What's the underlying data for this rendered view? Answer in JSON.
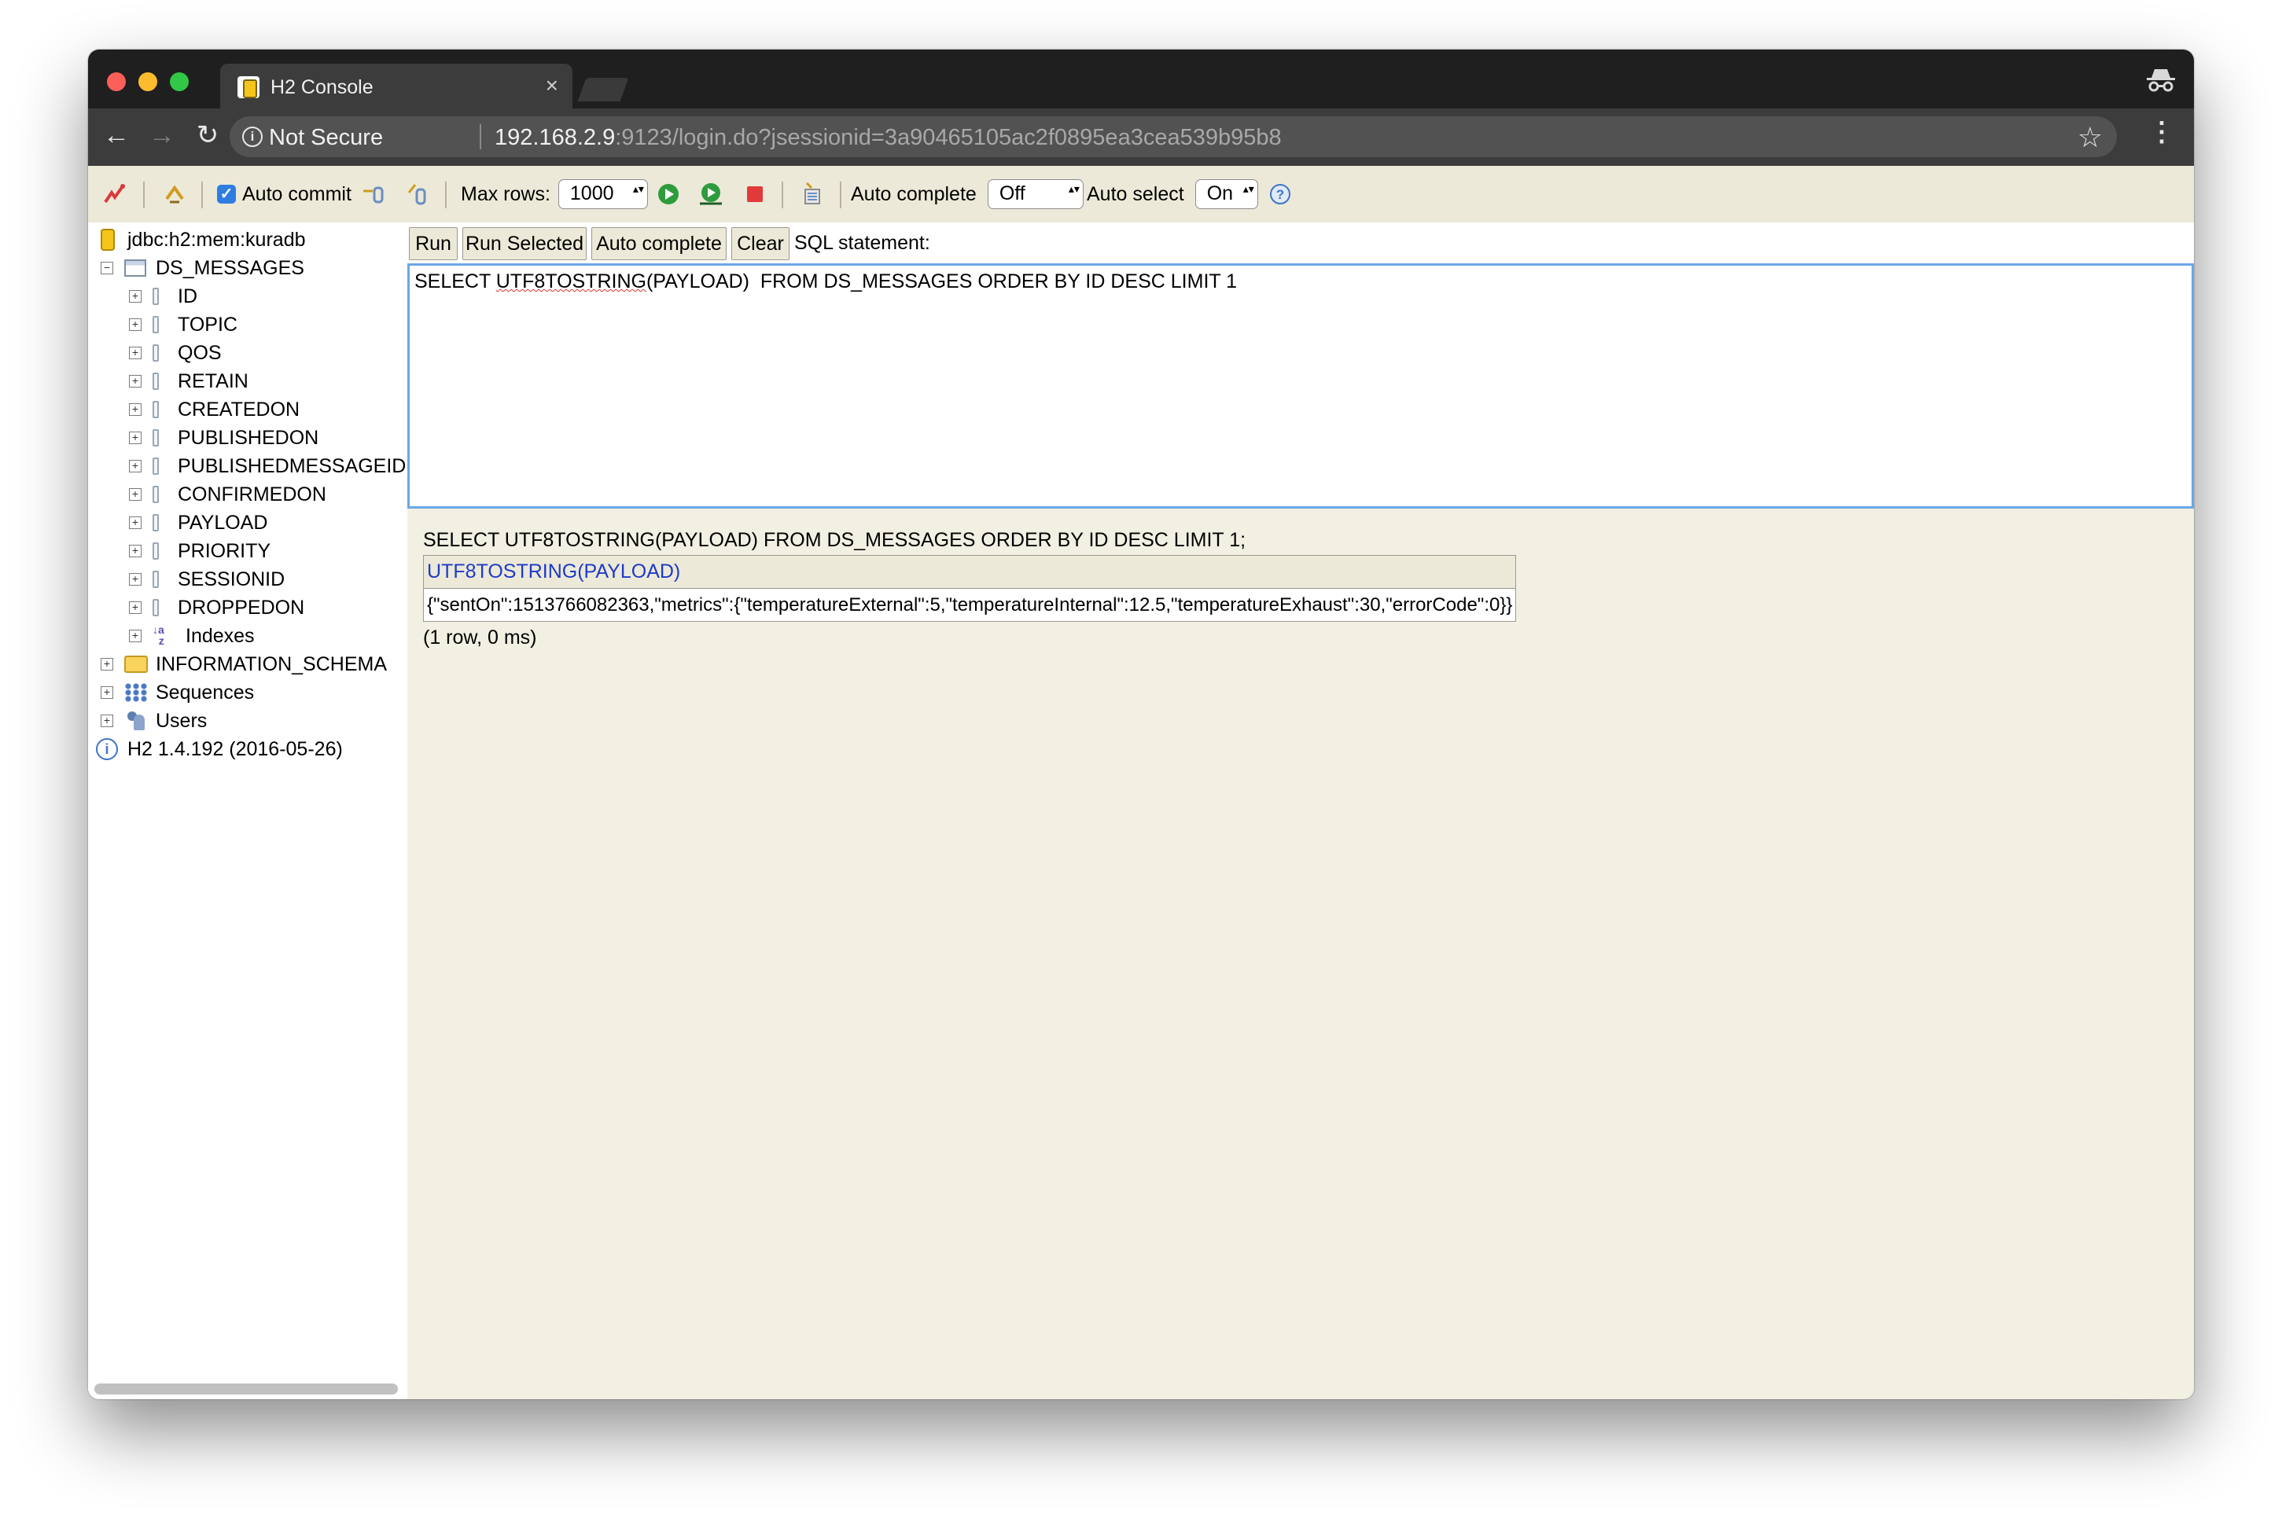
{
  "browser": {
    "tab_title": "H2 Console",
    "tab_close": "×",
    "security_label": "Not Secure",
    "url_host": "192.168.2.9",
    "url_rest": ":9123/login.do?jsessionid=3a90465105ac2f0895ea3cea539b95b8"
  },
  "toolbar": {
    "auto_commit_label": "Auto commit",
    "auto_commit_checked": true,
    "max_rows_label": "Max rows:",
    "max_rows_value": "1000",
    "auto_complete_label": "Auto complete",
    "auto_complete_value": "Off",
    "auto_select_label": "Auto select",
    "auto_select_value": "On"
  },
  "tree": {
    "connection": "jdbc:h2:mem:kuradb",
    "table": "DS_MESSAGES",
    "columns": [
      "ID",
      "TOPIC",
      "QOS",
      "RETAIN",
      "CREATEDON",
      "PUBLISHEDON",
      "PUBLISHEDMESSAGEID",
      "CONFIRMEDON",
      "PAYLOAD",
      "PRIORITY",
      "SESSIONID",
      "DROPPEDON"
    ],
    "indexes": "Indexes",
    "information_schema": "INFORMATION_SCHEMA",
    "sequences": "Sequences",
    "users": "Users",
    "version": "H2 1.4.192 (2016-05-26)"
  },
  "query": {
    "run": "Run",
    "run_selected": "Run Selected",
    "auto_complete": "Auto complete",
    "clear": "Clear",
    "sql_label": "SQL statement:",
    "sql_pre": "SELECT ",
    "sql_fn": "UTF8TOSTRING",
    "sql_post": "(PAYLOAD)  FROM DS_MESSAGES ORDER BY ID DESC LIMIT 1"
  },
  "result": {
    "executed_sql": "SELECT UTF8TOSTRING(PAYLOAD)  FROM DS_MESSAGES ORDER BY ID DESC LIMIT 1;",
    "column_header": "UTF8TOSTRING(PAYLOAD)",
    "rows": [
      "{\"sentOn\":1513766082363,\"metrics\":{\"temperatureExternal\":5,\"temperatureInternal\":12.5,\"temperatureExhaust\":30,\"errorCode\":0}}"
    ],
    "row_count": "(1 row, 0 ms)"
  }
}
